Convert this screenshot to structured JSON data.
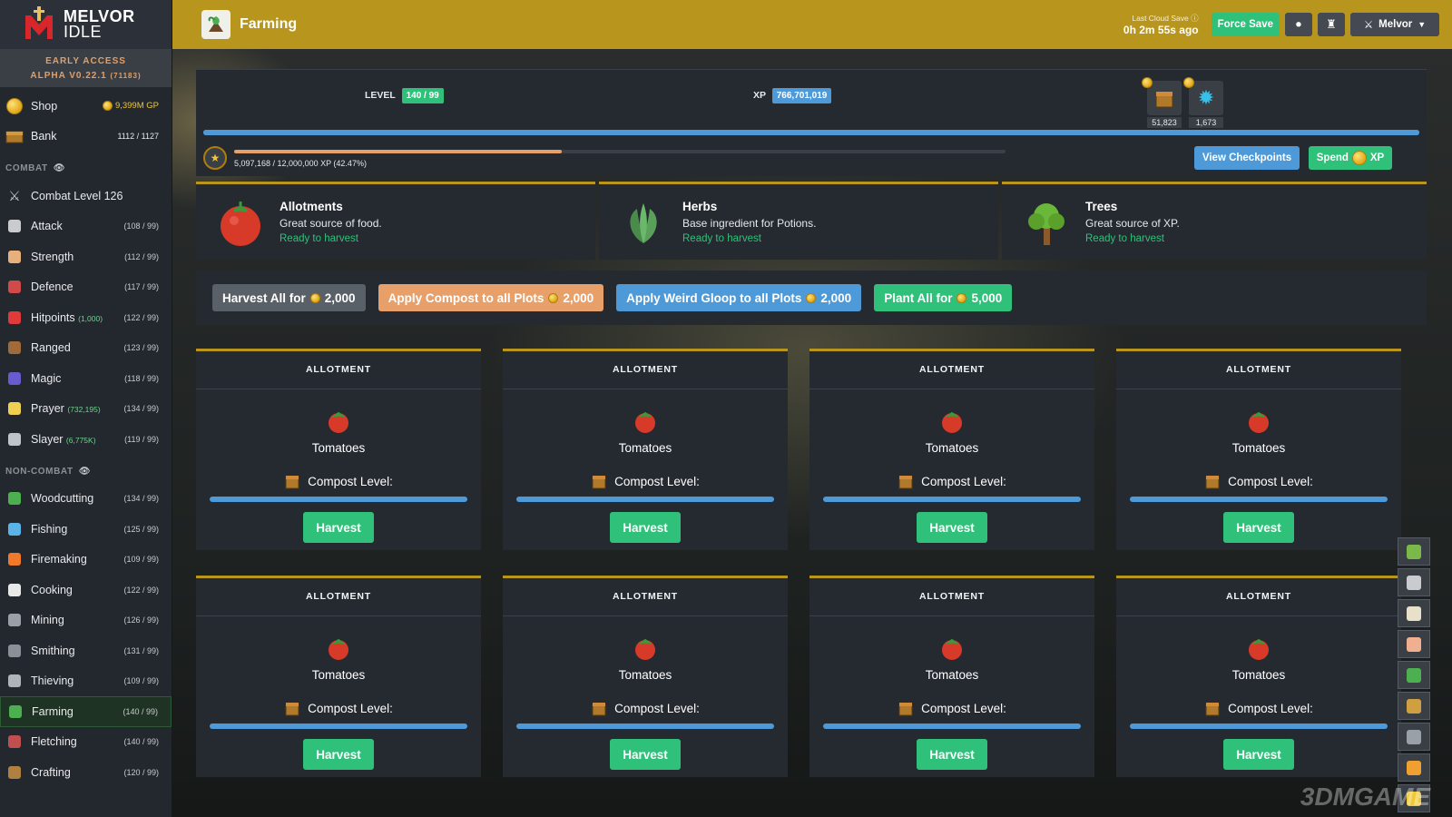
{
  "app": {
    "logo_line1": "MELVOR",
    "logo_line2": "IDLE",
    "early_access": "EARLY ACCESS",
    "version": "ALPHA V0.22.1",
    "build": "(71183)"
  },
  "sidebar": {
    "shop": {
      "label": "Shop",
      "gp": "9,399M GP"
    },
    "bank": {
      "label": "Bank",
      "count": "1112 / 1127"
    },
    "combat_header": "COMBAT",
    "combat_level": "Combat Level 126",
    "combat": [
      {
        "label": "Attack",
        "extra": "",
        "level": "(108 / 99)",
        "icon": "sword-icon",
        "color": "#c9cbcf"
      },
      {
        "label": "Strength",
        "extra": "",
        "level": "(112 / 99)",
        "icon": "fist-icon",
        "color": "#e8b07a"
      },
      {
        "label": "Defence",
        "extra": "",
        "level": "(117 / 99)",
        "icon": "shield-icon",
        "color": "#d04a4a"
      },
      {
        "label": "Hitpoints",
        "extra": "(1,000)",
        "level": "(122 / 99)",
        "icon": "heart-icon",
        "color": "#e03a3a"
      },
      {
        "label": "Ranged",
        "extra": "",
        "level": "(123 / 99)",
        "icon": "bow-icon",
        "color": "#a06a3a"
      },
      {
        "label": "Magic",
        "extra": "",
        "level": "(118 / 99)",
        "icon": "wizard-hat-icon",
        "color": "#6a5ad0"
      },
      {
        "label": "Prayer",
        "extra": "(732,195)",
        "level": "(134 / 99)",
        "icon": "prayer-star-icon",
        "color": "#f0d050"
      },
      {
        "label": "Slayer",
        "extra": "(6,775K)",
        "level": "(119 / 99)",
        "icon": "slayer-icon",
        "color": "#c0c4c8"
      }
    ],
    "noncombat_header": "NON-COMBAT",
    "noncombat": [
      {
        "label": "Woodcutting",
        "level": "(134 / 99)",
        "icon": "tree-icon",
        "color": "#4caf50",
        "active": false
      },
      {
        "label": "Fishing",
        "level": "(125 / 99)",
        "icon": "fish-icon",
        "color": "#5ab4e8",
        "active": false
      },
      {
        "label": "Firemaking",
        "level": "(109 / 99)",
        "icon": "fire-icon",
        "color": "#f07a2a",
        "active": false
      },
      {
        "label": "Cooking",
        "level": "(122 / 99)",
        "icon": "chef-hat-icon",
        "color": "#e8e8e8",
        "active": false
      },
      {
        "label": "Mining",
        "level": "(126 / 99)",
        "icon": "pickaxe-icon",
        "color": "#9aa0a8",
        "active": false
      },
      {
        "label": "Smithing",
        "level": "(131 / 99)",
        "icon": "anvil-icon",
        "color": "#8a9098",
        "active": false
      },
      {
        "label": "Thieving",
        "level": "(109 / 99)",
        "icon": "thief-icon",
        "color": "#b0b4b8",
        "active": false
      },
      {
        "label": "Farming",
        "level": "(140 / 99)",
        "icon": "farming-icon",
        "color": "#4caf50",
        "active": true
      },
      {
        "label": "Fletching",
        "level": "(140 / 99)",
        "icon": "arrow-icon",
        "color": "#c05050",
        "active": false
      },
      {
        "label": "Crafting",
        "level": "(120 / 99)",
        "icon": "crafting-icon",
        "color": "#b08040",
        "active": false
      }
    ]
  },
  "header": {
    "title": "Farming",
    "cloud_label": "Last Cloud Save",
    "cloud_time": "0h 2m 55s ago",
    "force_save": "Force Save",
    "account": "Melvor"
  },
  "skill": {
    "level_label": "LEVEL",
    "level_value": "140 / 99",
    "xp_label": "XP",
    "xp_value": "766,701,019",
    "xp_progress": 1.0,
    "mastery_text": "5,097,168 / 12,000,000 XP (42.47%)",
    "mastery_fraction": 0.4247,
    "pool_counts": [
      "51,823",
      "1,673"
    ],
    "view_checkpoints": "View Checkpoints",
    "spend_label": "Spend",
    "spend_suffix": "XP"
  },
  "categories": [
    {
      "title": "Allotments",
      "desc": "Great source of food.",
      "status": "Ready to harvest",
      "icon": "tomato-icon"
    },
    {
      "title": "Herbs",
      "desc": "Base ingredient for Potions.",
      "status": "Ready to harvest",
      "icon": "herb-icon"
    },
    {
      "title": "Trees",
      "desc": "Great source of XP.",
      "status": "Ready to harvest",
      "icon": "tree-icon"
    }
  ],
  "actions": [
    {
      "label": "Harvest All for",
      "cost": "2,000",
      "color": "#5a6068"
    },
    {
      "label": "Apply Compost to all Plots",
      "cost": "2,000",
      "color": "#e8a06a"
    },
    {
      "label": "Apply Weird Gloop to all Plots",
      "cost": "2,000",
      "color": "#4e9ad9"
    },
    {
      "label": "Plant All for",
      "cost": "5,000",
      "color": "#2fc079"
    }
  ],
  "plots": [
    {
      "header": "ALLOTMENT",
      "crop": "Tomatoes",
      "compost_label": "Compost Level:",
      "button": "Harvest"
    },
    {
      "header": "ALLOTMENT",
      "crop": "Tomatoes",
      "compost_label": "Compost Level:",
      "button": "Harvest"
    },
    {
      "header": "ALLOTMENT",
      "crop": "Tomatoes",
      "compost_label": "Compost Level:",
      "button": "Harvest"
    },
    {
      "header": "ALLOTMENT",
      "crop": "Tomatoes",
      "compost_label": "Compost Level:",
      "button": "Harvest"
    },
    {
      "header": "ALLOTMENT",
      "crop": "Tomatoes",
      "compost_label": "Compost Level:",
      "button": "Harvest"
    },
    {
      "header": "ALLOTMENT",
      "crop": "Tomatoes",
      "compost_label": "Compost Level:",
      "button": "Harvest"
    },
    {
      "header": "ALLOTMENT",
      "crop": "Tomatoes",
      "compost_label": "Compost Level:",
      "button": "Harvest"
    },
    {
      "header": "ALLOTMENT",
      "crop": "Tomatoes",
      "compost_label": "Compost Level:",
      "button": "Harvest"
    }
  ],
  "dock_icons": [
    "herb-icon",
    "axe-icon",
    "scroll-icon",
    "face-icon",
    "cape-icon",
    "lantern-icon",
    "wolf-icon",
    "medal-icon",
    "trophy-icon"
  ],
  "watermark": "3DMGAME"
}
